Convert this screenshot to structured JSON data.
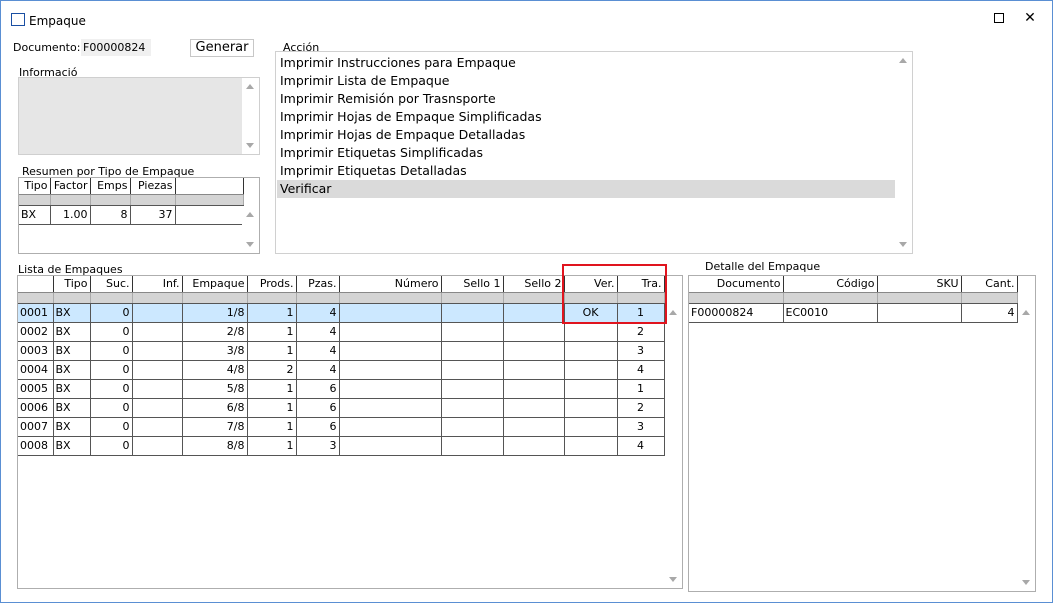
{
  "window": {
    "title": "Empaque"
  },
  "documento": {
    "label": "Documento:",
    "value": "F00000824"
  },
  "generar_label": "Generar",
  "informacion_label": "Informació",
  "resumen": {
    "label": "Resumen por Tipo de Empaque",
    "columns": [
      "Tipo",
      "Factor",
      "Emps",
      "Piezas"
    ],
    "rows": [
      [
        "BX",
        "1.00",
        "8",
        "37"
      ]
    ]
  },
  "accion": {
    "label": "Acción",
    "items": [
      "Imprimir Instrucciones para Empaque",
      "Imprimir Lista de Empaque",
      "Imprimir Remisión por Trasnsporte",
      "Imprimir Hojas de Empaque Simplificadas",
      "Imprimir Hojas de Empaque Detalladas",
      "Imprimir Etiquetas Simplificadas",
      "Imprimir Etiquetas Detalladas",
      "Verificar"
    ],
    "selected": "Verificar"
  },
  "lista": {
    "label": "Lista de Empaques",
    "columns": [
      "",
      "Tipo",
      "Suc.",
      "Inf.",
      "Empaque",
      "Prods.",
      "Pzas.",
      "Número",
      "Sello 1",
      "Sello 2",
      "Ver.",
      "Tra."
    ],
    "rows": [
      [
        "0001",
        "BX",
        "0",
        "",
        "1/8",
        "1",
        "4",
        "",
        "",
        "",
        "OK",
        "1"
      ],
      [
        "0002",
        "BX",
        "0",
        "",
        "2/8",
        "1",
        "4",
        "",
        "",
        "",
        "",
        "2"
      ],
      [
        "0003",
        "BX",
        "0",
        "",
        "3/8",
        "1",
        "4",
        "",
        "",
        "",
        "",
        "3"
      ],
      [
        "0004",
        "BX",
        "0",
        "",
        "4/8",
        "2",
        "4",
        "",
        "",
        "",
        "",
        "4"
      ],
      [
        "0005",
        "BX",
        "0",
        "",
        "5/8",
        "1",
        "6",
        "",
        "",
        "",
        "",
        "1"
      ],
      [
        "0006",
        "BX",
        "0",
        "",
        "6/8",
        "1",
        "6",
        "",
        "",
        "",
        "",
        "2"
      ],
      [
        "0007",
        "BX",
        "0",
        "",
        "7/8",
        "1",
        "6",
        "",
        "",
        "",
        "",
        "3"
      ],
      [
        "0008",
        "BX",
        "0",
        "",
        "8/8",
        "1",
        "3",
        "",
        "",
        "",
        "",
        "4"
      ]
    ]
  },
  "detalle": {
    "label": "Detalle del Empaque",
    "columns": [
      "Documento",
      "Código",
      "SKU",
      "Cant."
    ],
    "rows": [
      [
        "F00000824",
        "EC0010",
        "",
        "4"
      ]
    ]
  },
  "colors": {
    "selection": "#cce8ff",
    "highlight_box": "#e0141e",
    "window_border": "#5a8fd3"
  }
}
